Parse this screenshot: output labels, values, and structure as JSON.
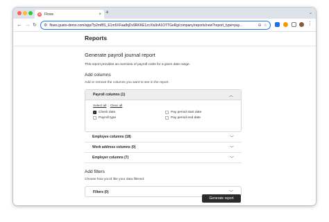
{
  "browser": {
    "tab_title": "Flows",
    "favicon_letter": "G",
    "url": "flows.gusto-demo.com/app/?p2mf8S_E1m5XFaa8qDv9RKKE1zcXlu9rA1OTTGeRg/company/reports/new?report_type=pay...",
    "accent_color": "#1a73e8"
  },
  "page": {
    "title": "Reports"
  },
  "report": {
    "heading": "Generate payroll journal report",
    "description": "This report provides an overview of payroll costs for a given date range.",
    "add_columns": {
      "heading": "Add columns",
      "subtitle": "Add or remove the columns you want to see in the report."
    },
    "payroll_columns": {
      "label": "Payroll columns (1)",
      "select_all": "Select all",
      "separator": "|",
      "clear_all": "Clear all",
      "options": [
        {
          "label": "Check date",
          "checked": true
        },
        {
          "label": "Pay period start date",
          "checked": false
        },
        {
          "label": "Payroll type",
          "checked": false
        },
        {
          "label": "Pay period end date",
          "checked": false
        }
      ]
    },
    "sections": [
      {
        "label": "Employee columns (18)"
      },
      {
        "label": "Work address columns (0)"
      },
      {
        "label": "Employer columns (7)"
      }
    ],
    "add_filters": {
      "heading": "Add filters",
      "subtitle": "Choose how you'd like your data filtered:",
      "filters_label": "Filters (0)"
    },
    "generate_button": "Generate report"
  }
}
